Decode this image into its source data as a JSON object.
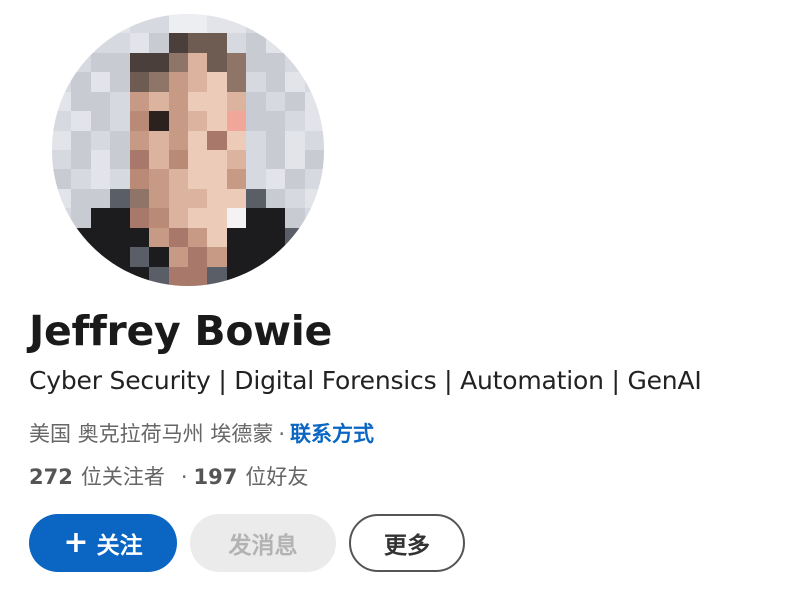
{
  "profile": {
    "name": "Jeffrey Bowie",
    "headline": "Cyber Security | Digital Forensics | Automation | GenAI",
    "location": "美国 奥克拉荷马州 埃德蒙",
    "location_separator": "·",
    "contact_link": "联系方式",
    "followers_count": "272",
    "followers_label": "位关注者",
    "stats_separator": "·",
    "connections_count": "197",
    "connections_label": "位好友"
  },
  "actions": {
    "follow_icon": "+",
    "follow_label": "关注",
    "message_label": "发消息",
    "more_label": "更多"
  },
  "colors": {
    "accent": "#0a66c2",
    "disabled_bg": "#ebebeb",
    "disabled_text": "#b3b3b3"
  }
}
